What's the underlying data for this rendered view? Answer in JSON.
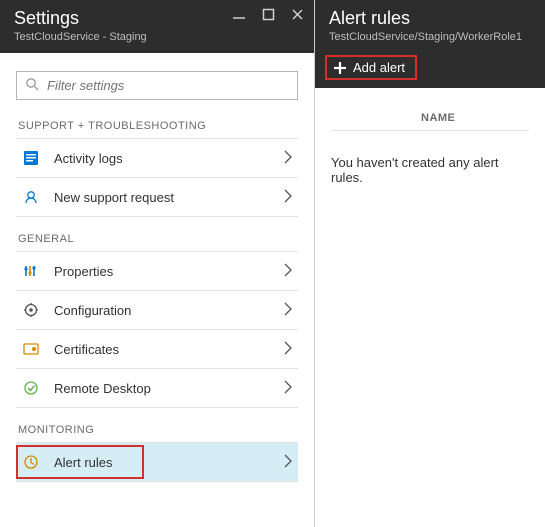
{
  "left": {
    "title": "Settings",
    "subtitle": "TestCloudService - Staging",
    "search_placeholder": "Filter settings",
    "sections": {
      "support": {
        "label": "SUPPORT + TROUBLESHOOTING",
        "items": [
          {
            "label": "Activity logs"
          },
          {
            "label": "New support request"
          }
        ]
      },
      "general": {
        "label": "GENERAL",
        "items": [
          {
            "label": "Properties"
          },
          {
            "label": "Configuration"
          },
          {
            "label": "Certificates"
          },
          {
            "label": "Remote Desktop"
          }
        ]
      },
      "monitoring": {
        "label": "MONITORING",
        "items": [
          {
            "label": "Alert rules"
          }
        ]
      }
    }
  },
  "right": {
    "title": "Alert rules",
    "subtitle": "TestCloudService/Staging/WorkerRole1",
    "add_label": "Add alert",
    "column_header": "NAME",
    "empty_message": "You haven't created any alert rules."
  }
}
